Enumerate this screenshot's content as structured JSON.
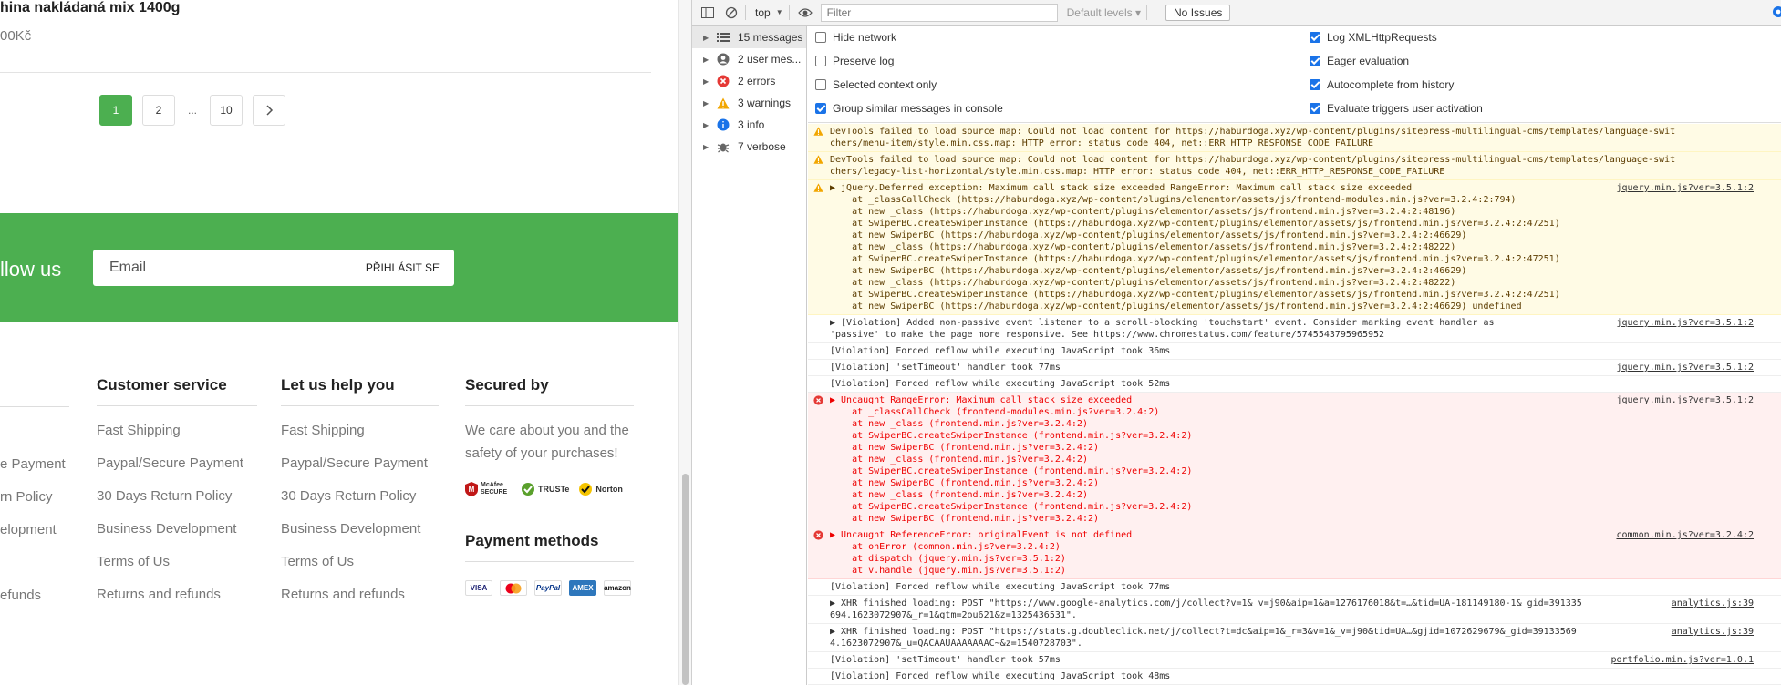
{
  "site": {
    "product_title": "hina nakládaná mix 1400g",
    "product_price": "00Kč",
    "pagination": [
      "1",
      "2",
      "...",
      "10"
    ],
    "newsletter": {
      "label": "llow us",
      "placeholder": "Email",
      "button": "PŘIHLÁSIT SE"
    },
    "col0": [
      "e Payment",
      "rn Policy",
      "elopment",
      "efunds"
    ],
    "customer_service": {
      "title": "Customer service",
      "links": [
        "Fast Shipping",
        "Paypal/Secure Payment",
        "30 Days Return Policy",
        "Business Development",
        "Terms of Us",
        "Returns and refunds"
      ]
    },
    "help": {
      "title": "Let us help you",
      "links": [
        "Fast Shipping",
        "Paypal/Secure Payment",
        "30 Days Return Policy",
        "Business Development",
        "Terms of Us",
        "Returns and refunds"
      ]
    },
    "secured": {
      "title": "Secured by",
      "text": "We care about you and the safety of your purchases!",
      "badges": [
        "McAfee SECURE",
        "TRUSTe",
        "Norton"
      ]
    },
    "payment": {
      "title": "Payment methods",
      "methods": [
        "VISA",
        "MC",
        "PayPal",
        "AMEX",
        "amazon"
      ]
    }
  },
  "devtools": {
    "context": "top",
    "filter_placeholder": "Filter",
    "levels": "Default levels",
    "issues": "No Issues",
    "sidebar": [
      {
        "label": "15 messages",
        "icon": "list-icon"
      },
      {
        "label": "2 user mes...",
        "icon": "user-icon"
      },
      {
        "label": "2 errors",
        "icon": "error-icon"
      },
      {
        "label": "3 warnings",
        "icon": "warning-icon"
      },
      {
        "label": "3 info",
        "icon": "info-icon"
      },
      {
        "label": "7 verbose",
        "icon": "bug-icon"
      }
    ],
    "settings_left": [
      {
        "label": "Hide network",
        "checked": false
      },
      {
        "label": "Preserve log",
        "checked": false
      },
      {
        "label": "Selected context only",
        "checked": false
      },
      {
        "label": "Group similar messages in console",
        "checked": true
      }
    ],
    "settings_right": [
      {
        "label": "Log XMLHttpRequests",
        "checked": true
      },
      {
        "label": "Eager evaluation",
        "checked": true
      },
      {
        "label": "Autocomplete from history",
        "checked": true
      },
      {
        "label": "Evaluate triggers user activation",
        "checked": true
      }
    ],
    "messages": [
      {
        "type": "warn",
        "src": "",
        "lines": [
          "DevTools failed to load source map: Could not load content for https://haburdoga.xyz/wp-content/plugins/sitepress-multilingual-cms/templates/language-swit",
          "chers/menu-item/style.min.css.map: HTTP error: status code 404, net::ERR_HTTP_RESPONSE_CODE_FAILURE"
        ]
      },
      {
        "type": "warn",
        "src": "",
        "lines": [
          "DevTools failed to load source map: Could not load content for https://haburdoga.xyz/wp-content/plugins/sitepress-multilingual-cms/templates/language-swit",
          "chers/legacy-list-horizontal/style.min.css.map: HTTP error: status code 404, net::ERR_HTTP_RESPONSE_CODE_FAILURE"
        ]
      },
      {
        "type": "warn",
        "src": "jquery.min.js?ver=3.5.1:2",
        "lines": [
          "▶ jQuery.Deferred exception: Maximum call stack size exceeded RangeError: Maximum call stack size exceeded",
          "    at _classCallCheck (https://haburdoga.xyz/wp-content/plugins/elementor/assets/js/frontend-modules.min.js?ver=3.2.4:2:794)",
          "    at new _class (https://haburdoga.xyz/wp-content/plugins/elementor/assets/js/frontend.min.js?ver=3.2.4:2:48196)",
          "    at SwiperBC.createSwiperInstance (https://haburdoga.xyz/wp-content/plugins/elementor/assets/js/frontend.min.js?ver=3.2.4:2:47251)",
          "    at new SwiperBC (https://haburdoga.xyz/wp-content/plugins/elementor/assets/js/frontend.min.js?ver=3.2.4:2:46629)",
          "    at new _class (https://haburdoga.xyz/wp-content/plugins/elementor/assets/js/frontend.min.js?ver=3.2.4:2:48222)",
          "    at SwiperBC.createSwiperInstance (https://haburdoga.xyz/wp-content/plugins/elementor/assets/js/frontend.min.js?ver=3.2.4:2:47251)",
          "    at new SwiperBC (https://haburdoga.xyz/wp-content/plugins/elementor/assets/js/frontend.min.js?ver=3.2.4:2:46629)",
          "    at new _class (https://haburdoga.xyz/wp-content/plugins/elementor/assets/js/frontend.min.js?ver=3.2.4:2:48222)",
          "    at SwiperBC.createSwiperInstance (https://haburdoga.xyz/wp-content/plugins/elementor/assets/js/frontend.min.js?ver=3.2.4:2:47251)",
          "    at new SwiperBC (https://haburdoga.xyz/wp-content/plugins/elementor/assets/js/frontend.min.js?ver=3.2.4:2:46629) undefined"
        ]
      },
      {
        "type": "vio",
        "src": "jquery.min.js?ver=3.5.1:2",
        "lines": [
          "▶ [Violation] Added non-passive event listener to a scroll-blocking 'touchstart' event. Consider marking event handler as",
          "'passive' to make the page more responsive. See https://www.chromestatus.com/feature/5745543795965952"
        ]
      },
      {
        "type": "vio",
        "src": "",
        "lines": [
          "[Violation] Forced reflow while executing JavaScript took 36ms"
        ]
      },
      {
        "type": "vio",
        "src": "jquery.min.js?ver=3.5.1:2",
        "lines": [
          "[Violation] 'setTimeout' handler took 77ms"
        ]
      },
      {
        "type": "vio",
        "src": "",
        "lines": [
          "[Violation] Forced reflow while executing JavaScript took 52ms"
        ]
      },
      {
        "type": "err",
        "src": "jquery.min.js?ver=3.5.1:2",
        "lines": [
          "▶ Uncaught RangeError: Maximum call stack size exceeded",
          "    at _classCallCheck (frontend-modules.min.js?ver=3.2.4:2)",
          "    at new _class (frontend.min.js?ver=3.2.4:2)",
          "    at SwiperBC.createSwiperInstance (frontend.min.js?ver=3.2.4:2)",
          "    at new SwiperBC (frontend.min.js?ver=3.2.4:2)",
          "    at new _class (frontend.min.js?ver=3.2.4:2)",
          "    at SwiperBC.createSwiperInstance (frontend.min.js?ver=3.2.4:2)",
          "    at new SwiperBC (frontend.min.js?ver=3.2.4:2)",
          "    at new _class (frontend.min.js?ver=3.2.4:2)",
          "    at SwiperBC.createSwiperInstance (frontend.min.js?ver=3.2.4:2)",
          "    at new SwiperBC (frontend.min.js?ver=3.2.4:2)"
        ]
      },
      {
        "type": "err",
        "src": "common.min.js?ver=3.2.4:2",
        "lines": [
          "▶ Uncaught ReferenceError: originalEvent is not defined",
          "    at onError (common.min.js?ver=3.2.4:2)",
          "    at dispatch (jquery.min.js?ver=3.5.1:2)",
          "    at v.handle (jquery.min.js?ver=3.5.1:2)"
        ]
      },
      {
        "type": "vio",
        "src": "",
        "lines": [
          "[Violation] Forced reflow while executing JavaScript took 77ms"
        ]
      },
      {
        "type": "vio",
        "src": "analytics.js:39",
        "lines": [
          "▶ XHR finished loading: POST \"https://www.google-analytics.com/j/collect?v=1&_v=j90&aip=1&a=1276176018&t=…&tid=UA-181149180-1&_gid=391335",
          "694.1623072907&_r=1&gtm=2ou621&z=1325436531\"."
        ]
      },
      {
        "type": "vio",
        "src": "analytics.js:39",
        "lines": [
          "▶ XHR finished loading: POST \"https://stats.g.doubleclick.net/j/collect?t=dc&aip=1&_r=3&v=1&_v=j90&tid=UA…&gjid=1072629679&_gid=39133569",
          "4.1623072907&_u=QACAAUAAAAAAAC~&z=1540728703\"."
        ]
      },
      {
        "type": "vio",
        "src": "portfolio.min.js?ver=1.0.1",
        "lines": [
          "[Violation] 'setTimeout' handler took 57ms"
        ]
      },
      {
        "type": "vio",
        "src": "",
        "lines": [
          "[Violation] Forced reflow while executing JavaScript took 48ms"
        ]
      }
    ]
  }
}
